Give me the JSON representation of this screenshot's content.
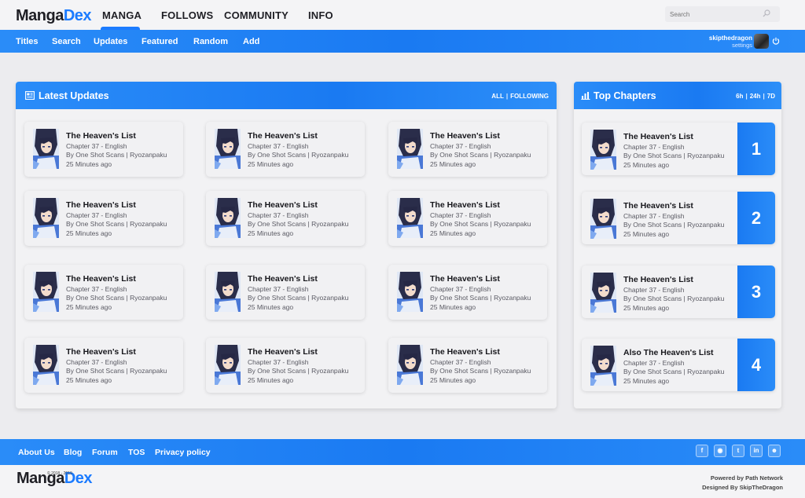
{
  "brand": {
    "logo_prefix": "Manga",
    "logo_suffix": "Dex",
    "copyright": "© 2018 - 2019"
  },
  "main_nav": [
    "MANGA",
    "FOLLOWS",
    "COMMUNITY",
    "INFO"
  ],
  "search": {
    "placeholder": "Search"
  },
  "sub_nav": [
    "Titles",
    "Search",
    "Updates",
    "Featured",
    "Random",
    "Add"
  ],
  "user": {
    "name": "skipthedragon",
    "settings": "settings"
  },
  "latest": {
    "title": "Latest Updates",
    "filter_all": "ALL",
    "filter_sep": "|",
    "filter_following": "FOLLOWING",
    "cards": [
      {
        "title": "The Heaven's List",
        "chapter": "Chapter 37 - English",
        "group": "By One Shot Scans | Ryozanpaku",
        "time": "25 Minutes ago"
      },
      {
        "title": "The Heaven's List",
        "chapter": "Chapter 37 - English",
        "group": "By One Shot Scans | Ryozanpaku",
        "time": "25 Minutes ago"
      },
      {
        "title": "The Heaven's List",
        "chapter": "Chapter 37 - English",
        "group": "By One Shot Scans | Ryozanpaku",
        "time": "25 Minutes ago"
      },
      {
        "title": "The Heaven's List",
        "chapter": "Chapter 37 - English",
        "group": "By One Shot Scans | Ryozanpaku",
        "time": "25 Minutes ago"
      },
      {
        "title": "The Heaven's List",
        "chapter": "Chapter 37 - English",
        "group": "By One Shot Scans | Ryozanpaku",
        "time": "25 Minutes ago"
      },
      {
        "title": "The Heaven's List",
        "chapter": "Chapter 37 - English",
        "group": "By One Shot Scans | Ryozanpaku",
        "time": "25 Minutes ago"
      },
      {
        "title": "The Heaven's List",
        "chapter": "Chapter 37 - English",
        "group": "By One Shot Scans | Ryozanpaku",
        "time": "25 Minutes ago"
      },
      {
        "title": "The Heaven's List",
        "chapter": "Chapter 37 - English",
        "group": "By One Shot Scans | Ryozanpaku",
        "time": "25 Minutes ago"
      },
      {
        "title": "The Heaven's List",
        "chapter": "Chapter 37 - English",
        "group": "By One Shot Scans | Ryozanpaku",
        "time": "25 Minutes ago"
      },
      {
        "title": "The Heaven's List",
        "chapter": "Chapter 37 - English",
        "group": "By One Shot Scans | Ryozanpaku",
        "time": "25 Minutes ago"
      },
      {
        "title": "The Heaven's List",
        "chapter": "Chapter 37 - English",
        "group": "By One Shot Scans | Ryozanpaku",
        "time": "25 Minutes ago"
      },
      {
        "title": "The Heaven's List",
        "chapter": "Chapter 37 - English",
        "group": "By One Shot Scans | Ryozanpaku",
        "time": "25 Minutes ago"
      }
    ]
  },
  "top": {
    "title": "Top Chapters",
    "filter_6h": "6h",
    "filter_sep": "|",
    "filter_24h": "24h",
    "filter_7d": "7D",
    "cards": [
      {
        "title": "The Heaven's List",
        "chapter": "Chapter 37 - English",
        "group": "By One Shot Scans | Ryozanpaku",
        "time": "25 Minutes ago",
        "rank": "1"
      },
      {
        "title": "The Heaven's List",
        "chapter": "Chapter 37 - English",
        "group": "By One Shot Scans | Ryozanpaku",
        "time": "25 Minutes ago",
        "rank": "2"
      },
      {
        "title": "The Heaven's List",
        "chapter": "Chapter 37 - English",
        "group": "By One Shot Scans | Ryozanpaku",
        "time": "25 Minutes ago",
        "rank": "3"
      },
      {
        "title": "Also The Heaven's List",
        "chapter": "Chapter 37 - English",
        "group": "By One Shot Scans | Ryozanpaku",
        "time": "25 Minutes ago",
        "rank": "4"
      }
    ]
  },
  "footer": {
    "links": [
      "About Us",
      "Blog",
      "Forum",
      "TOS",
      "Privacy policy"
    ],
    "social": [
      {
        "icon": "facebook-icon",
        "glyph": "f"
      },
      {
        "icon": "discord-icon",
        "glyph": "◉"
      },
      {
        "icon": "twitter-icon",
        "glyph": "t"
      },
      {
        "icon": "linkedin-icon",
        "glyph": "in"
      },
      {
        "icon": "reddit-icon",
        "glyph": "☻"
      }
    ],
    "powered": "Powered by Path Network",
    "designed": "Designed By SkipTheDragon"
  },
  "colors": {
    "accent": "#1b7bff",
    "bar_gradient_start": "#2a8cf8",
    "bar_gradient_end": "#1a7af2"
  }
}
